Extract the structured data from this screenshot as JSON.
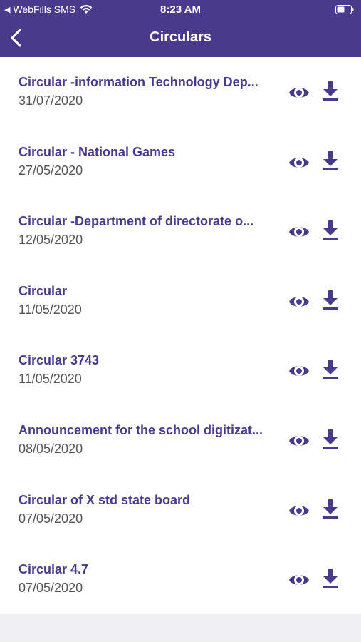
{
  "status_bar": {
    "back_indicator": "◀",
    "carrier": "WebFills SMS",
    "time": "8:23 AM"
  },
  "nav": {
    "title": "Circulars",
    "back_icon": "chevron-left-icon"
  },
  "colors": {
    "brand": "#4a3a8c",
    "date_text": "#555555",
    "page_bg": "#efeff4"
  },
  "circulars": [
    {
      "title": "Circular -information Technology Dep...",
      "date": "31/07/2020"
    },
    {
      "title": "Circular - National Games",
      "date": "27/05/2020"
    },
    {
      "title": "Circular  -Department of directorate o...",
      "date": "12/05/2020"
    },
    {
      "title": "Circular",
      "date": "11/05/2020"
    },
    {
      "title": "Circular 3743",
      "date": "11/05/2020"
    },
    {
      "title": "Announcement for the school digitizat...",
      "date": "08/05/2020"
    },
    {
      "title": "Circular of X std state board",
      "date": "07/05/2020"
    },
    {
      "title": "Circular 4.7",
      "date": "07/05/2020"
    }
  ],
  "row_icons": [
    "eye-icon",
    "download-icon"
  ]
}
